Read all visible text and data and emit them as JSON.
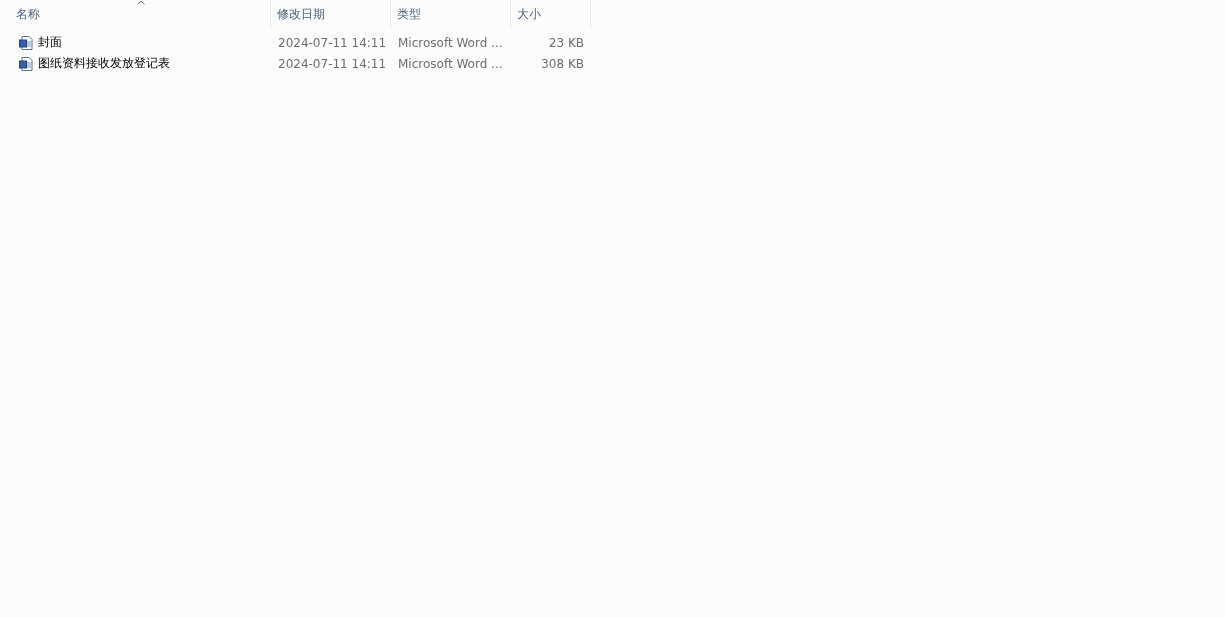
{
  "columns": [
    {
      "label": "名称",
      "sorted": true
    },
    {
      "label": "修改日期",
      "sorted": false
    },
    {
      "label": "类型",
      "sorted": false
    },
    {
      "label": "大小",
      "sorted": false
    }
  ],
  "rows": [
    {
      "name": "封面",
      "modified": "2024-07-11 14:11",
      "type": "Microsoft Word ...",
      "size": "23 KB"
    },
    {
      "name": "图纸资料接收发放登记表",
      "modified": "2024-07-11 14:11",
      "type": "Microsoft Word ...",
      "size": "308 KB"
    }
  ]
}
